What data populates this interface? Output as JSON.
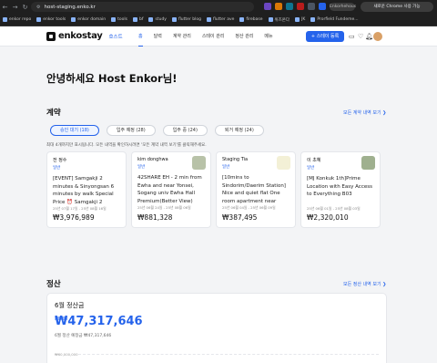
{
  "browser": {
    "url": "host-staging.enko.kr",
    "profile": "Enkorhehous",
    "update_label": "새로운 Chrome 사용 가능",
    "bookmarks": [
      "enkor repo",
      "enkor tools",
      "enkor domain",
      "tools",
      "bf",
      "study",
      "flutter blog",
      "flutter ave",
      "firebase",
      "위즈온다",
      "JK",
      "Prorfield Fundeme..."
    ]
  },
  "nav": {
    "brand": "enkostay",
    "host_tag": "호스트",
    "menu": [
      "홈",
      "달력",
      "계약 관리",
      "스테이 관리",
      "정산 관리",
      "메뉴"
    ],
    "register_label": "+ 스테이 등록",
    "icons": [
      "chat-icon",
      "heart-icon",
      "bell-icon",
      "avatar"
    ]
  },
  "greeting": "안녕하세요 Host Enkor님!",
  "contracts": {
    "title": "계약",
    "see_all": "모든 계약 내역 보기 ❯",
    "tabs": [
      {
        "label": "승인 대기 (18)",
        "active": true
      },
      {
        "label": "입주 예정 (28)",
        "active": false
      },
      {
        "label": "입주 중 (24)",
        "active": false
      },
      {
        "label": "퇴거 예정 (24)",
        "active": false
      }
    ],
    "hint": "최대 4개까지만 표시됩니다. 모든 내역을 확인하시려면 '모든 계약 내역 보기'를 클릭해주세요.",
    "cards": [
      {
        "guest": "전 정수",
        "status": "일반",
        "title": "[EVENT] Samgakji 2 minutes & Sinyongsan 6 minutes by walk Special Price ⏰ Samgakji 2 minutes & Sinyongsan 6 minutes",
        "dates": "25년 07월 17일 - 25년 08월 16일",
        "price": "₩3,976,989",
        "thumb": "#ffffff"
      },
      {
        "guest": "kim donghwa",
        "status": "일반",
        "title": "42SHARE EH - 2 min from Ewha and near Yonsei, Sogang univ Ewha Hall Premium(Better View)",
        "dates": "25년 06월 24일 - 25년 08월 06일",
        "price": "₩881,328",
        "thumb": "#b8c2a8"
      },
      {
        "guest": "Staging Tia",
        "status": "일반",
        "title": "[10mins to Sindorim/Daerim Station] Nice and quiet flat One room apartment near Sindorim/Daerim station",
        "dates": "25년 06월 04일 - 25년 06월 09일",
        "price": "₩387,495",
        "thumb": "#f3f0d6"
      },
      {
        "guest": "이 초혜",
        "status": "일반",
        "title": "[MJ Konkuk 1th]Prime Location with Easy Access to Everything B03",
        "dates": "25년 06월 01일 - 25년 08월 03일",
        "price": "₩2,320,010",
        "thumb": "#9fb08f"
      }
    ]
  },
  "settlement": {
    "title": "정산",
    "see_all": "모든 정산 내역 보기 ❯",
    "month_label": "6월 정산금",
    "amount": "₩47,317,646",
    "expected": "6월 정산 예정금 ₩47,317,646",
    "axis_top": "₩60,000,000"
  }
}
